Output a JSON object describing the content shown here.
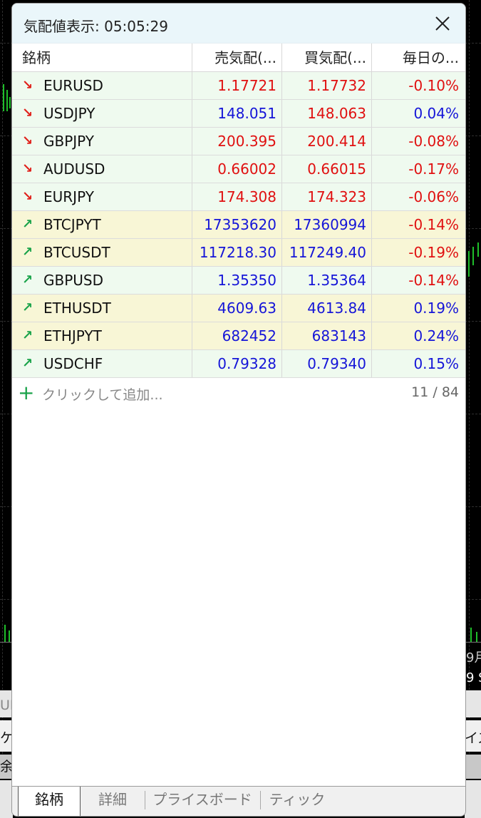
{
  "window": {
    "title": "気配値表示: 05:05:29"
  },
  "columns": {
    "symbol": "銘柄",
    "bid": "売気配(...",
    "ask": "買気配(...",
    "daily": "毎日の..."
  },
  "rows": [
    {
      "symbol": "EURUSD",
      "bid": "1.17721",
      "ask": "1.17732",
      "change": "-0.10%"
    },
    {
      "symbol": "USDJPY",
      "bid": "148.051",
      "ask": "148.063",
      "change": "0.04%"
    },
    {
      "symbol": "GBPJPY",
      "bid": "200.395",
      "ask": "200.414",
      "change": "-0.08%"
    },
    {
      "symbol": "AUDUSD",
      "bid": "0.66002",
      "ask": "0.66015",
      "change": "-0.17%"
    },
    {
      "symbol": "EURJPY",
      "bid": "174.308",
      "ask": "174.323",
      "change": "-0.06%"
    },
    {
      "symbol": "BTCJPYT",
      "bid": "17353620",
      "ask": "17360994",
      "change": "-0.14%"
    },
    {
      "symbol": "BTCUSDT",
      "bid": "117218.30",
      "ask": "117249.40",
      "change": "-0.19%"
    },
    {
      "symbol": "GBPUSD",
      "bid": "1.35350",
      "ask": "1.35364",
      "change": "-0.14%"
    },
    {
      "symbol": "ETHUSDT",
      "bid": "4609.63",
      "ask": "4613.84",
      "change": "0.19%"
    },
    {
      "symbol": "ETHJPYT",
      "bid": "682452",
      "ask": "683143",
      "change": "0.24%"
    },
    {
      "symbol": "USDCHF",
      "bid": "0.79328",
      "ask": "0.79340",
      "change": "0.15%"
    }
  ],
  "add_row": {
    "label": "クリックして追加...",
    "count": "11 / 84"
  },
  "tabs": [
    {
      "label": "銘柄"
    },
    {
      "label": "詳細"
    },
    {
      "label": "プライスボード"
    },
    {
      "label": "ティック"
    }
  ],
  "background": {
    "left_fragments": [
      "UR",
      "ケ",
      "余"
    ],
    "right_fragments": [
      "9月",
      "9 S",
      "イズ"
    ]
  },
  "colors": {
    "down_price": "#e01010",
    "up_price": "#1515d8",
    "arrow_down": "#e0201a",
    "arrow_up": "#1aa34a",
    "row_green": "#effaef",
    "row_yellow": "#f8f6d6"
  }
}
